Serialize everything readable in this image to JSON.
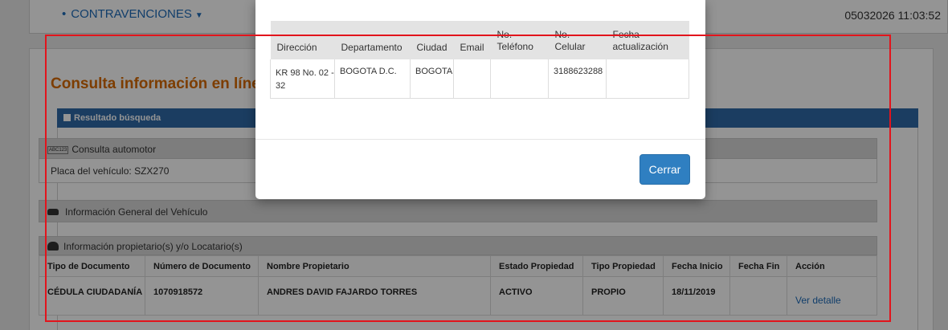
{
  "nav": {
    "menu_label": "CONTRAVENCIONES",
    "datetime": "05032026 11:03:52"
  },
  "page": {
    "title": "Consulta información en línea",
    "result_header": "Resultado búsqueda",
    "auto_section": {
      "badge": "ABC123",
      "title": "Consulta automotor",
      "plate_label": "Placa del vehículo: SZX270"
    },
    "vehicle_section": {
      "title": "Información General del Vehículo"
    },
    "owners_section": {
      "title": "Información propietario(s) y/o Locatario(s)",
      "columns": [
        "Tipo de Documento",
        "Número de Documento",
        "Nombre Propietario",
        "Estado Propiedad",
        "Tipo Propiedad",
        "Fecha Inicio",
        "Fecha Fin",
        "Acción"
      ],
      "rows": [
        {
          "tipo_doc": "CÉDULA CIUDADANÍA",
          "num_doc": "1070918572",
          "nombre": "ANDRES DAVID FAJARDO TORRES",
          "estado": "ACTIVO",
          "tipo_prop": "PROPIO",
          "fecha_inicio": "18/11/2019",
          "fecha_fin": "",
          "accion": "Ver detalle"
        }
      ]
    }
  },
  "modal": {
    "columns": [
      "Dirección",
      "Departamento",
      "Ciudad",
      "Email",
      "No.\nTeléfono",
      "No.\nCelular",
      "Fecha\nactualización"
    ],
    "row": {
      "direccion": "KR 98 No. 02 - 32",
      "departamento": "BOGOTA D.C.",
      "ciudad": "BOGOTA",
      "email": "",
      "telefono": "",
      "celular": "3188623288",
      "fecha": ""
    },
    "close_label": "Cerrar"
  },
  "colors": {
    "accent_blue": "#2f6aa8",
    "title_orange": "#d76a00",
    "annotation_red": "#e2141c"
  }
}
